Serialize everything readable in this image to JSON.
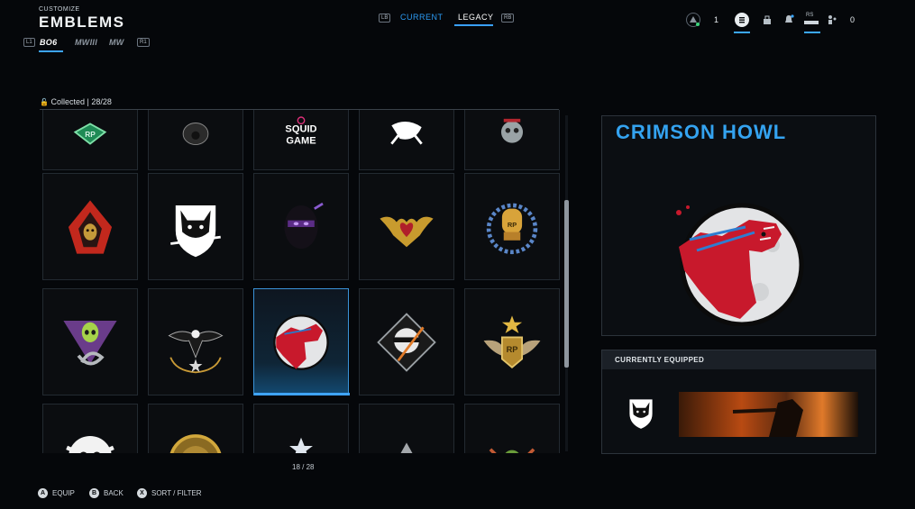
{
  "header": {
    "subtitle": "CUSTOMIZE",
    "title": "EMBLEMS"
  },
  "game_tabs": {
    "lb_hint": "L1",
    "rb_hint": "R1",
    "items": [
      {
        "label": "BO6",
        "selected": true
      },
      {
        "label": "MWIII",
        "selected": false
      },
      {
        "label": "MW",
        "selected": false
      }
    ]
  },
  "top_tabs": {
    "lb": "LB",
    "rb": "RB",
    "current": "CURRENT",
    "legacy": "LEGACY",
    "active": "LEGACY"
  },
  "top_right": {
    "level": "1",
    "count": "0",
    "rs_hint": "RS"
  },
  "collection": {
    "text": "Collected | 28/28"
  },
  "grid": {
    "pager": "18 / 28",
    "emblems": [
      {
        "name": "rp-badge-green"
      },
      {
        "name": "gas-mask"
      },
      {
        "name": "squid-game",
        "text": "SQUID GAME"
      },
      {
        "name": "scorpion"
      },
      {
        "name": "skull-crown"
      },
      {
        "name": "hooded-reaper"
      },
      {
        "name": "wolf-shield"
      },
      {
        "name": "purple-ninja"
      },
      {
        "name": "bat-heart"
      },
      {
        "name": "boxing-glove-rp"
      },
      {
        "name": "alien-snake"
      },
      {
        "name": "eagle-star"
      },
      {
        "name": "crimson-howl"
      },
      {
        "name": "skull-blade"
      },
      {
        "name": "winged-rp"
      },
      {
        "name": "skull-cross"
      },
      {
        "name": "gold-medallion"
      },
      {
        "name": "star-wings"
      },
      {
        "name": "grey-shard"
      },
      {
        "name": "green-crest"
      }
    ],
    "selected_index": 12
  },
  "detail": {
    "title": "CRIMSON HOWL"
  },
  "equipped": {
    "label": "CURRENTLY EQUIPPED"
  },
  "footer": [
    {
      "key": "A",
      "label": "EQUIP"
    },
    {
      "key": "B",
      "label": "BACK"
    },
    {
      "key": "X",
      "label": "SORT / FILTER"
    }
  ],
  "colors": {
    "accent": "#39a0ff",
    "title_blue": "#34a3f0",
    "crimson": "#c8192c"
  }
}
